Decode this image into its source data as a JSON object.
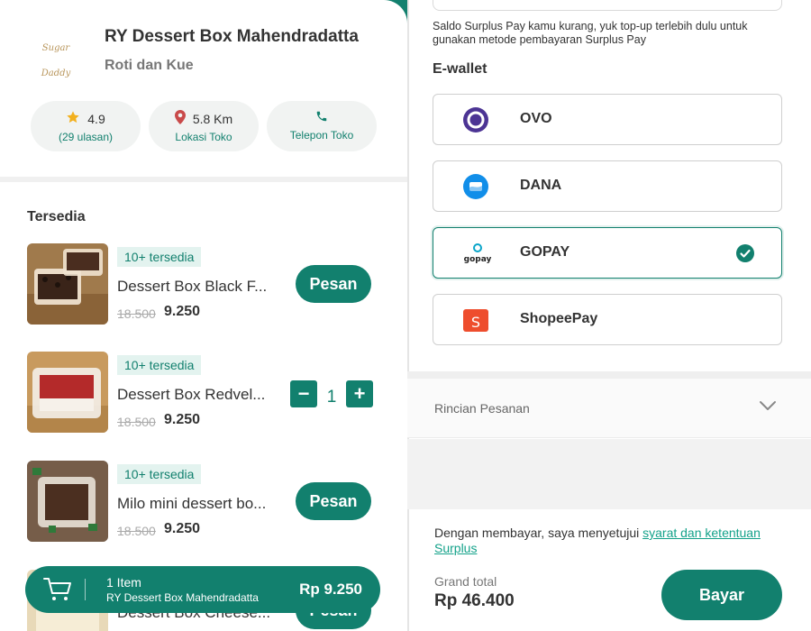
{
  "store": {
    "name": "RY Dessert Box Mahendradatta",
    "category": "Roti dan Kue",
    "logo_text": "Sugar Daddy",
    "rating": "4.9",
    "reviews": "(29 ulasan)",
    "distance": "5.8 Km",
    "location_label": "Lokasi Toko",
    "phone_label": "Telepon Toko"
  },
  "section_title": "Tersedia",
  "products": [
    {
      "badge": "10+ tersedia",
      "name": "Dessert Box Black F...",
      "old_price": "18.500",
      "price": "9.250",
      "button": "Pesan"
    },
    {
      "badge": "10+ tersedia",
      "name": "Dessert Box Redvel...",
      "old_price": "18.500",
      "price": "9.250",
      "qty": "1",
      "minus": "−",
      "plus": "+"
    },
    {
      "badge": "10+ tersedia",
      "name": "Milo mini dessert bo...",
      "old_price": "18.500",
      "price": "9.250",
      "button": "Pesan"
    },
    {
      "name": "Dessert Box Cheese...",
      "button": "Pesan"
    }
  ],
  "cart": {
    "count": "1 Item",
    "store": "RY Dessert Box Mahendradatta",
    "total": "Rp 9.250"
  },
  "payment": {
    "saldo_message": "Saldo Surplus Pay kamu kurang, yuk top-up terlebih dulu untuk gunakan metode pembayaran Surplus Pay",
    "ewallet_title": "E-wallet",
    "wallets": [
      {
        "name": "OVO",
        "icon": "ovo-icon"
      },
      {
        "name": "DANA",
        "icon": "dana-icon"
      },
      {
        "name": "GOPAY",
        "icon": "gopay-icon",
        "logo_text": "gopay",
        "selected": true
      },
      {
        "name": "ShopeePay",
        "icon": "shopeepay-icon"
      }
    ],
    "rincian_label": "Rincian Pesanan",
    "terms_prefix": "Dengan membayar, saya menyetujui ",
    "terms_link": "syarat dan ketentuan Surplus",
    "grand_total_label": "Grand total",
    "grand_total_value": "Rp 46.400",
    "pay_button": "Bayar"
  },
  "colors": {
    "accent": "#12806e",
    "badge_bg": "#e3f3ef",
    "link": "#14a28a"
  }
}
